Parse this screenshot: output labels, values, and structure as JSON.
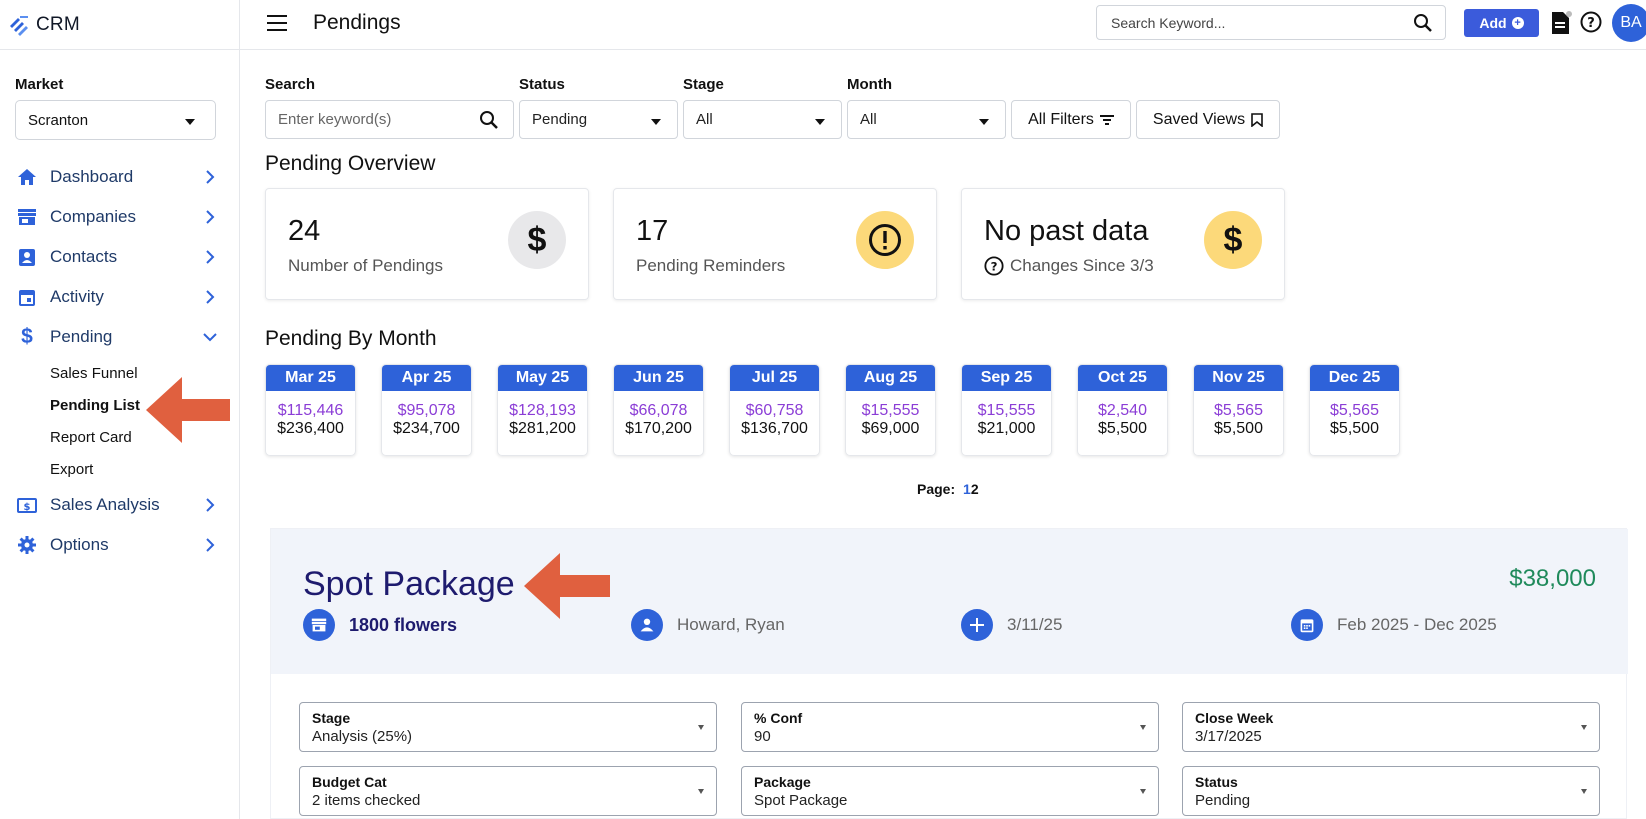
{
  "brand": {
    "name": "CRM",
    "accent": "#2e62d9"
  },
  "market": {
    "label": "Market",
    "value": "Scranton"
  },
  "nav": {
    "items": [
      {
        "label": "Dashboard",
        "icon": "home-icon"
      },
      {
        "label": "Companies",
        "icon": "store-icon"
      },
      {
        "label": "Contacts",
        "icon": "contact-card-icon"
      },
      {
        "label": "Activity",
        "icon": "calendar-icon"
      },
      {
        "label": "Pending",
        "icon": "dollar-icon"
      },
      {
        "label": "Sales Analysis",
        "icon": "money-icon"
      },
      {
        "label": "Options",
        "icon": "gear-icon"
      }
    ],
    "pending_sub": [
      "Sales Funnel",
      "Pending List",
      "Report Card",
      "Export"
    ]
  },
  "header": {
    "title": "Pendings",
    "search_placeholder": "Search Keyword...",
    "add_label": "Add",
    "avatar_initials": "BA"
  },
  "filters": {
    "search_label": "Search",
    "search_placeholder": "Enter keyword(s)",
    "status_label": "Status",
    "status_value": "Pending",
    "stage_label": "Stage",
    "stage_value": "All",
    "month_label": "Month",
    "month_value": "All",
    "all_filters": "All Filters",
    "saved_views": "Saved Views"
  },
  "overview": {
    "title": "Pending Overview",
    "cards": [
      {
        "value": "24",
        "caption": "Number of Pendings",
        "icon": "dollar-icon",
        "circle": "#e8e8ea"
      },
      {
        "value": "17",
        "caption": "Pending Reminders",
        "icon": "alert-icon",
        "circle": "#fcd97a"
      },
      {
        "value": "No past data",
        "caption": "Changes Since 3/3",
        "icon": "dollar-icon",
        "circle": "#fcd97a"
      }
    ]
  },
  "by_month": {
    "title": "Pending By Month",
    "months": [
      {
        "label": "Mar 25",
        "weighted": "$115,446",
        "total": "$236,400"
      },
      {
        "label": "Apr 25",
        "weighted": "$95,078",
        "total": "$234,700"
      },
      {
        "label": "May 25",
        "weighted": "$128,193",
        "total": "$281,200"
      },
      {
        "label": "Jun 25",
        "weighted": "$66,078",
        "total": "$170,200"
      },
      {
        "label": "Jul 25",
        "weighted": "$60,758",
        "total": "$136,700"
      },
      {
        "label": "Aug 25",
        "weighted": "$15,555",
        "total": "$69,000"
      },
      {
        "label": "Sep 25",
        "weighted": "$15,555",
        "total": "$21,000"
      },
      {
        "label": "Oct 25",
        "weighted": "$2,540",
        "total": "$5,500"
      },
      {
        "label": "Nov 25",
        "weighted": "$5,565",
        "total": "$5,500"
      },
      {
        "label": "Dec 25",
        "weighted": "$5,565",
        "total": "$5,500"
      }
    ],
    "pager_label": "Page:",
    "pages": [
      "1",
      "2"
    ]
  },
  "detail": {
    "title": "Spot Package",
    "amount": "$38,000",
    "company": "1800 flowers",
    "owner": "Howard, Ryan",
    "date": "3/11/25",
    "flight": "Feb 2025 - Dec 2025",
    "fields": [
      {
        "label": "Stage",
        "value": "Analysis (25%)"
      },
      {
        "label": "% Conf",
        "value": "90"
      },
      {
        "label": "Close Week",
        "value": "3/17/2025"
      },
      {
        "label": "Budget Cat",
        "value": "2 items checked"
      },
      {
        "label": "Package",
        "value": "Spot Package"
      },
      {
        "label": "Status",
        "value": "Pending"
      }
    ]
  }
}
